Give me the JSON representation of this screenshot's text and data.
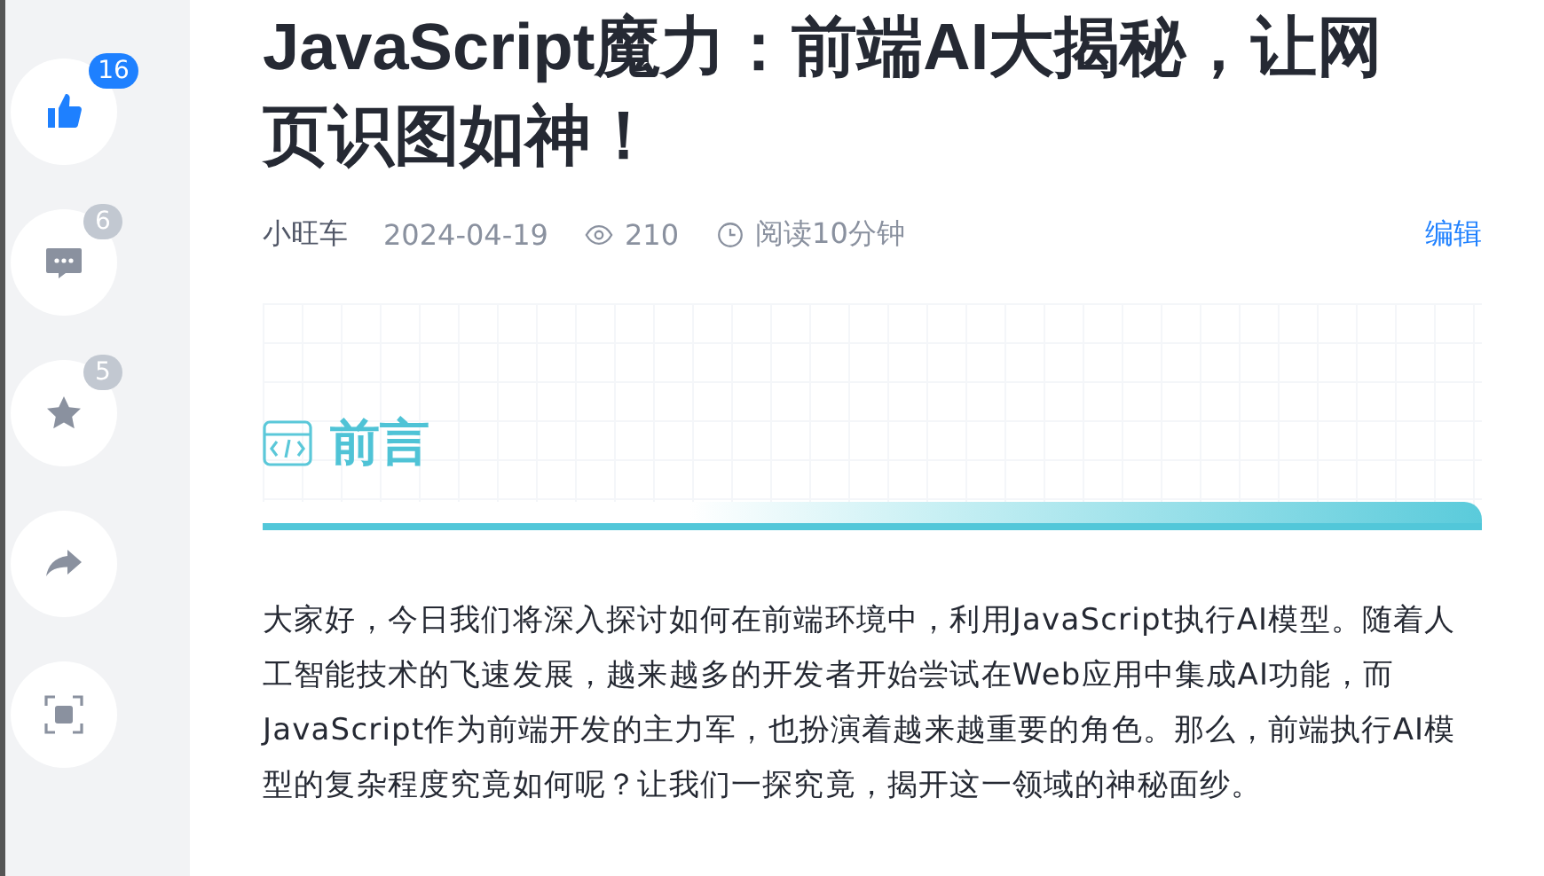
{
  "sidebar": {
    "actions": [
      {
        "kind": "like",
        "count": "16",
        "selected": true
      },
      {
        "kind": "comment",
        "count": "6",
        "selected": false
      },
      {
        "kind": "star",
        "count": "5",
        "selected": false
      },
      {
        "kind": "share",
        "selected": false
      },
      {
        "kind": "focus",
        "selected": false
      }
    ]
  },
  "article": {
    "title": "JavaScript魔力：前端AI大揭秘，让网页识图如神！",
    "author": "小旺车",
    "date": "2024-04-19",
    "views": "210",
    "read_time": "阅读10分钟",
    "edit_link": "编辑",
    "section_heading": "前言",
    "paragraph": "大家好，今日我们将深入探讨如何在前端环境中，利用JavaScript执行AI模型。随着人工智能技术的飞速发展，越来越多的开发者开始尝试在Web应用中集成AI功能，而JavaScript作为前端开发的主力军，也扮演着越来越重要的角色。那么，前端执行AI模型的复杂程度究竟如何呢？让我们一探究竟，揭开这一领域的神秘面纱。"
  }
}
